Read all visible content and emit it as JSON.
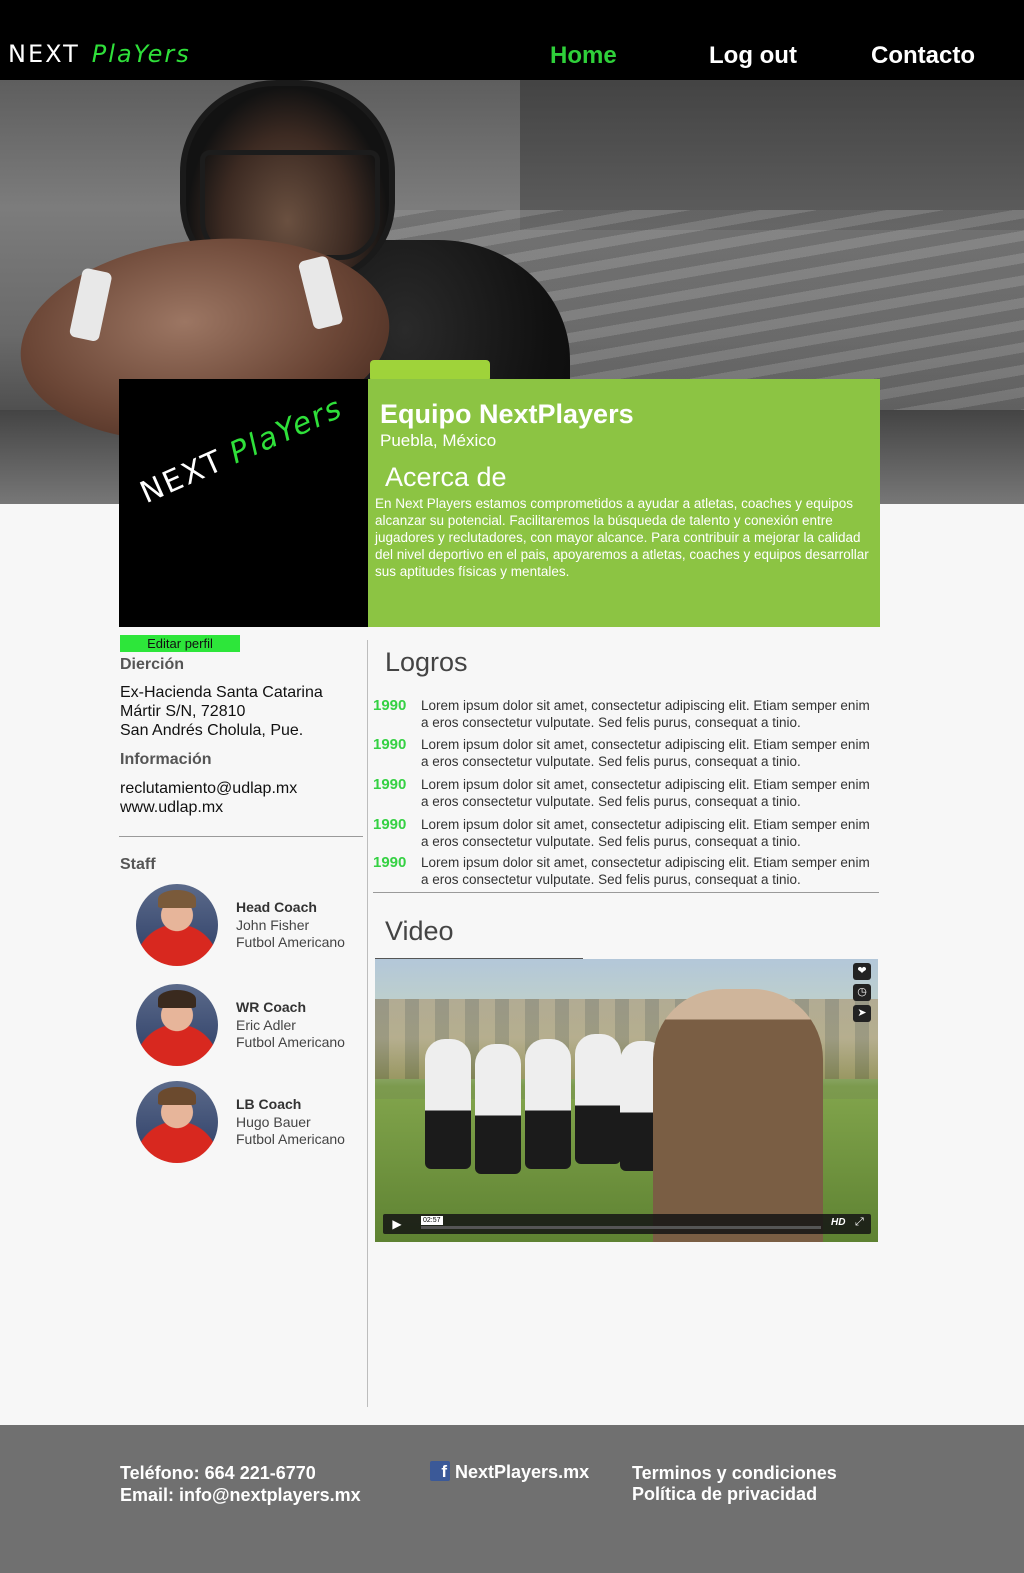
{
  "nav": {
    "logo_part1": "NEXT",
    "logo_part2": "PlaYers",
    "home": "Home",
    "logout": "Log out",
    "contact": "Contacto"
  },
  "profile": {
    "team_name": "Equipo NextPlayers",
    "location": "Puebla, México",
    "about_title": "Acerca de",
    "about_text": "En Next Players estamos comprometidos a ayudar a atletas, coaches y equipos alcanzar su potencial. Facilitaremos la búsqueda de talento y conexión entre jugadores y reclutadores, con mayor alcance. Para contribuir a mejorar la calidad del nivel deportivo en el pais, apoyaremos a atletas, coaches y equipos desarrollar sus aptitudes físicas y mentales.",
    "edit_button": "Editar perfil"
  },
  "address": {
    "label": "Dierción",
    "line1": "Ex-Hacienda Santa Catarina",
    "line2": "Mártir S/N, 72810",
    "line3": "San Andrés Cholula, Pue."
  },
  "info": {
    "label": "Información",
    "email": "reclutamiento@udlap.mx",
    "web": "www.udlap.mx"
  },
  "staff": {
    "label": "Staff",
    "members": [
      {
        "role": "Head Coach",
        "name": "John Fisher",
        "sport": "Futbol Americano"
      },
      {
        "role": "WR Coach",
        "name": "Eric Adler",
        "sport": "Futbol Americano"
      },
      {
        "role": "LB Coach",
        "name": "Hugo Bauer",
        "sport": "Futbol Americano"
      }
    ]
  },
  "achievements": {
    "title": "Logros",
    "items": [
      {
        "year": "1990",
        "text": "Lorem ipsum dolor sit amet, consectetur adipiscing elit. Etiam semper enim a eros consectetur vulputate. Sed felis purus, consequat a tinio."
      },
      {
        "year": "1990",
        "text": "Lorem ipsum dolor sit amet, consectetur adipiscing elit. Etiam semper enim a eros consectetur vulputate. Sed felis purus, consequat a tinio."
      },
      {
        "year": "1990",
        "text": "Lorem ipsum dolor sit amet, consectetur adipiscing elit. Etiam semper enim a eros consectetur vulputate. Sed felis purus, consequat a tinio."
      },
      {
        "year": "1990",
        "text": "Lorem ipsum dolor sit amet, consectetur adipiscing elit. Etiam semper enim a eros consectetur vulputate. Sed felis purus, consequat a tinio."
      },
      {
        "year": "1990",
        "text": "Lorem ipsum dolor sit amet, consectetur adipiscing elit. Etiam semper enim a eros consectetur vulputate. Sed felis purus, consequat a tinio."
      }
    ]
  },
  "video": {
    "title": "Video",
    "time": "02:57",
    "hd": "HD"
  },
  "footer": {
    "phone": "Teléfono: 664 221-6770",
    "email": "Email: info@nextplayers.mx",
    "facebook": "NextPlayers.mx",
    "terms": "Terminos y condiciones",
    "privacy": "Política de privacidad"
  },
  "colors": {
    "accent_green": "#8cc443",
    "bright_green": "#2de63a",
    "nav_active": "#2fd03a",
    "footer_bg": "#707070"
  },
  "icons": [
    "heart-icon",
    "clock-icon",
    "send-icon",
    "play-icon",
    "fullscreen-icon",
    "facebook-icon"
  ]
}
